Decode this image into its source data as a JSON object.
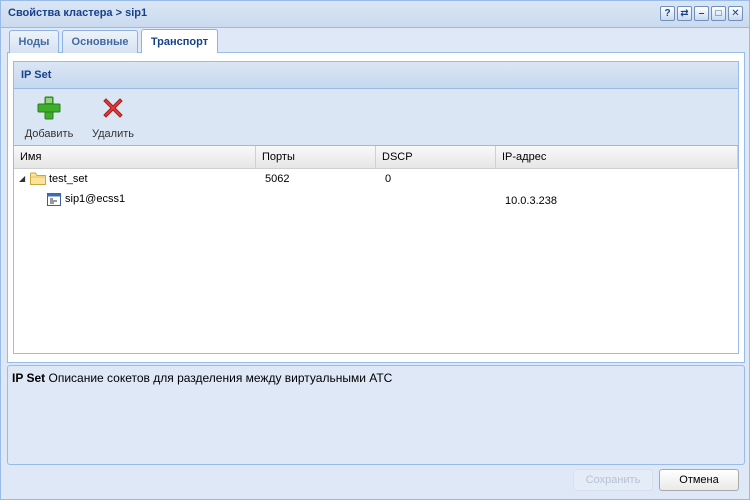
{
  "window": {
    "title": "Свойства кластера > sip1",
    "tools": [
      "?",
      "⇄",
      "–",
      "□",
      "✕"
    ]
  },
  "tabs": [
    {
      "label": "Ноды",
      "active": false
    },
    {
      "label": "Основные",
      "active": false
    },
    {
      "label": "Транспорт",
      "active": true
    }
  ],
  "panel": {
    "title": "IP Set",
    "toolbar": {
      "add_label": "Добавить",
      "delete_label": "Удалить"
    },
    "columns": [
      "Имя",
      "Порты",
      "DSCP",
      "IP-адрес"
    ],
    "rows": [
      {
        "name": "test_set",
        "ports": "5062",
        "dscp": "0",
        "ip": ""
      },
      {
        "name": "sip1@ecss1",
        "ports": "",
        "dscp": "",
        "ip": "10.0.3.238"
      }
    ]
  },
  "description": {
    "title": "IP Set",
    "text": "Описание сокетов для разделения между виртуальными АТС"
  },
  "buttons": {
    "save": "Сохранить",
    "cancel": "Отмена"
  },
  "colors": {
    "accent": "#15428b",
    "border": "#99bbe8",
    "background": "#dfe8f6"
  }
}
